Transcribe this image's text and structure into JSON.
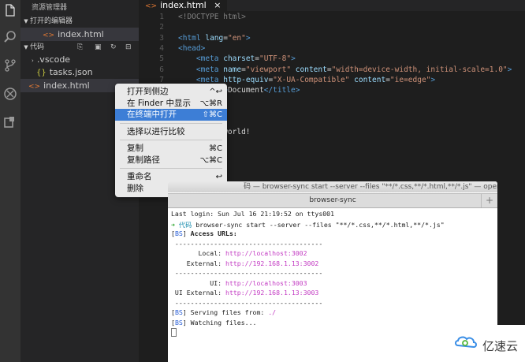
{
  "sidebar": {
    "title": "资源管理器",
    "open_editors_label": "打开的编辑器",
    "open_editors": [
      {
        "icon": "<>",
        "name": "index.html"
      }
    ],
    "folder_label": "代码",
    "folder_items": [
      {
        "name": ".vscode",
        "type": "folder"
      },
      {
        "icon": "{}",
        "name": "tasks.json"
      },
      {
        "icon": "<>",
        "name": "index.html"
      }
    ]
  },
  "tab": {
    "title": "index.html",
    "close": "×"
  },
  "code_lines": [
    {
      "n": "1",
      "html": "<span class='g'>&lt;!DOCTYPE html&gt;</span>"
    },
    {
      "n": "2",
      "html": ""
    },
    {
      "n": "3",
      "html": "<span class='t'>&lt;html</span> <span class='a'>lang</span>=<span class='s'>\"en\"</span><span class='t'>&gt;</span>"
    },
    {
      "n": "4",
      "html": "<span class='t'>&lt;head&gt;</span>"
    },
    {
      "n": "5",
      "html": "    <span class='t'>&lt;meta</span> <span class='a'>charset</span>=<span class='s'>\"UTF-8\"</span><span class='t'>&gt;</span>"
    },
    {
      "n": "6",
      "html": "    <span class='t'>&lt;meta</span> <span class='a'>name</span>=<span class='s'>\"viewport\"</span> <span class='a'>content</span>=<span class='s'>\"width=device-width, initial-scale=1.0\"</span><span class='t'>&gt;</span>"
    },
    {
      "n": "7",
      "html": "    <span class='t'>&lt;meta</span> <span class='a'>http-equiv</span>=<span class='s'>\"X-UA-Compatible\"</span> <span class='a'>content</span>=<span class='s'>\"ie=edge\"</span><span class='t'>&gt;</span>"
    },
    {
      "n": "8",
      "html": "    <span class='t'>&lt;title&gt;</span>Document<span class='t'>&lt;/title&gt;</span>"
    },
    {
      "n": "9",
      "html": ""
    },
    {
      "n": "10",
      "html": ""
    },
    {
      "n": "11",
      "html": ""
    },
    {
      "n": "12",
      "html": "    hello world!"
    }
  ],
  "context_menu": {
    "groups": [
      [
        {
          "label": "打开到侧边",
          "shortcut": "^↩"
        },
        {
          "label": "在 Finder 中显示",
          "shortcut": "⌥⌘R"
        },
        {
          "label": "在终端中打开",
          "shortcut": "⇧⌘C",
          "highlighted": true
        }
      ],
      [
        {
          "label": "选择以进行比较",
          "shortcut": ""
        }
      ],
      [
        {
          "label": "复制",
          "shortcut": "⌘C"
        },
        {
          "label": "复制路径",
          "shortcut": "⌥⌘C"
        }
      ],
      [
        {
          "label": "重命名",
          "shortcut": "↩"
        },
        {
          "label": "删除",
          "shortcut": "⌘⌫"
        }
      ]
    ]
  },
  "terminal": {
    "window_title": "码 — browser-sync start --server --files \"**/*.css,**/*.html,**/*.js\" — open -",
    "tab_title": "browser-sync",
    "plus": "+",
    "lines": [
      "Last login: Sun Jul 16 21:19:52 on ttys001",
      "<span class='gr'>➜</span> <span class='cy'>代码</span> browser-sync start --server --files \"**/*.css,**/*.html,**/*.js\"",
      "[<span class='bl'>BS</span>] <b>Access URLs:</b>",
      " --------------------------------------",
      "       Local: <span class='pk'>http://localhost:3002</span>",
      "    External: <span class='pk'>http://192.168.1.13:3002</span>",
      " --------------------------------------",
      "          UI: <span class='pk'>http://localhost:3003</span>",
      " UI External: <span class='pk'>http://192.168.1.13:3003</span>",
      " --------------------------------------",
      "[<span class='bl'>BS</span>] Serving files from: <span class='pk'>./</span>",
      "[<span class='bl'>BS</span>] Watching files...",
      "<span class='cur'></span>"
    ]
  },
  "watermark": {
    "text": "亿速云"
  },
  "icons": {
    "files": "files-icon",
    "search": "search-icon",
    "scm": "source-control-icon",
    "debug": "debug-icon",
    "extensions": "extensions-icon"
  },
  "colors": {
    "accent": "#3d7ed6",
    "sidebar": "#252526",
    "editor": "#1e1e1e",
    "activity": "#333333"
  }
}
